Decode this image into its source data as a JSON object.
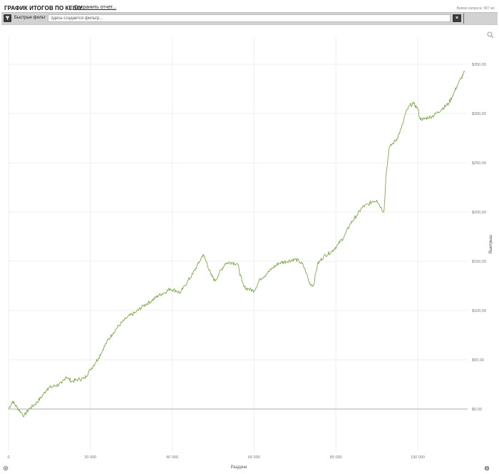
{
  "header": {
    "title": "ГРАФИК ИТОГОВ ПО КЕШУ",
    "save_label": "Сохранить отчет...",
    "timing": "Время запроса: 987 мс"
  },
  "filters": {
    "quick_label": "Быстрые фильт",
    "placeholder": "Здесь создается фильтр...",
    "clear_label": "×"
  },
  "icons": {
    "filter": "funnel-icon",
    "zoom": "magnifier-icon",
    "settings": "gear-icon",
    "info": "info-icon"
  },
  "colors": {
    "line": "#7cab4c",
    "zero_line": "#bdbdbd",
    "grid": "#efefef",
    "filterbar": "#d2d2d2"
  },
  "chart_data": {
    "type": "line",
    "xlabel": "Раздачи",
    "ylabel": "Выигрыш",
    "xlim": [
      0,
      112000
    ],
    "ylim": [
      -30,
      380
    ],
    "x_ticks": [
      0,
      20000,
      40000,
      60000,
      80000,
      100000
    ],
    "x_tick_labels": [
      "0",
      "20 000",
      "40 000",
      "60 000",
      "80 000",
      "100 000"
    ],
    "y_ticks": [
      0,
      50,
      100,
      150,
      200,
      250,
      300,
      350
    ],
    "y_tick_labels": [
      "$0,00",
      "$50,00",
      "$100,00",
      "$150,00",
      "$200,00",
      "$250,00",
      "$300,00",
      "$350,00"
    ],
    "grid": true,
    "series": [
      {
        "x": [
          0,
          1000,
          2000,
          3000,
          3800,
          5000,
          6500,
          8000,
          9500,
          11000,
          13000,
          14000,
          15500,
          17000,
          18500,
          20000,
          22000,
          24000,
          25500,
          27000,
          29000,
          31000,
          33000,
          35000,
          36500,
          38000,
          39500,
          41000,
          42000,
          43000,
          45000,
          46000,
          46500,
          47500,
          48500,
          49500,
          50500,
          51500,
          53000,
          54500,
          56000,
          57000,
          57500,
          58500,
          60000,
          61500,
          63000,
          64500,
          66000,
          68000,
          70000,
          71000,
          72000,
          72800,
          73500,
          74500,
          75500,
          77000,
          79000,
          80500,
          82000,
          83500,
          85000,
          86500,
          88000,
          89000,
          90000,
          91000,
          91500,
          91800,
          92200,
          93000,
          94000,
          95000,
          96000,
          96500,
          97000,
          98000,
          99000,
          100000,
          100500,
          101500,
          102500,
          103500,
          104500,
          106000,
          107500,
          108500,
          109500,
          110500,
          111500
        ],
        "y": [
          0,
          8,
          2,
          -3,
          -7,
          0,
          5,
          12,
          21,
          23,
          26,
          33,
          28,
          30,
          31,
          40,
          52,
          68,
          77,
          85,
          93,
          98,
          105,
          110,
          115,
          118,
          122,
          120,
          118,
          125,
          137,
          145,
          148,
          157,
          148,
          136,
          130,
          138,
          148,
          149,
          147,
          130,
          124,
          122,
          120,
          132,
          137,
          143,
          148,
          150,
          152,
          150,
          146,
          138,
          128,
          125,
          147,
          155,
          160,
          167,
          175,
          188,
          196,
          205,
          208,
          211,
          212,
          205,
          200,
          203,
          235,
          265,
          270,
          275,
          285,
          292,
          300,
          308,
          310,
          305,
          295,
          294,
          296,
          297,
          300,
          305,
          310,
          318,
          327,
          335,
          343
        ]
      }
    ]
  }
}
